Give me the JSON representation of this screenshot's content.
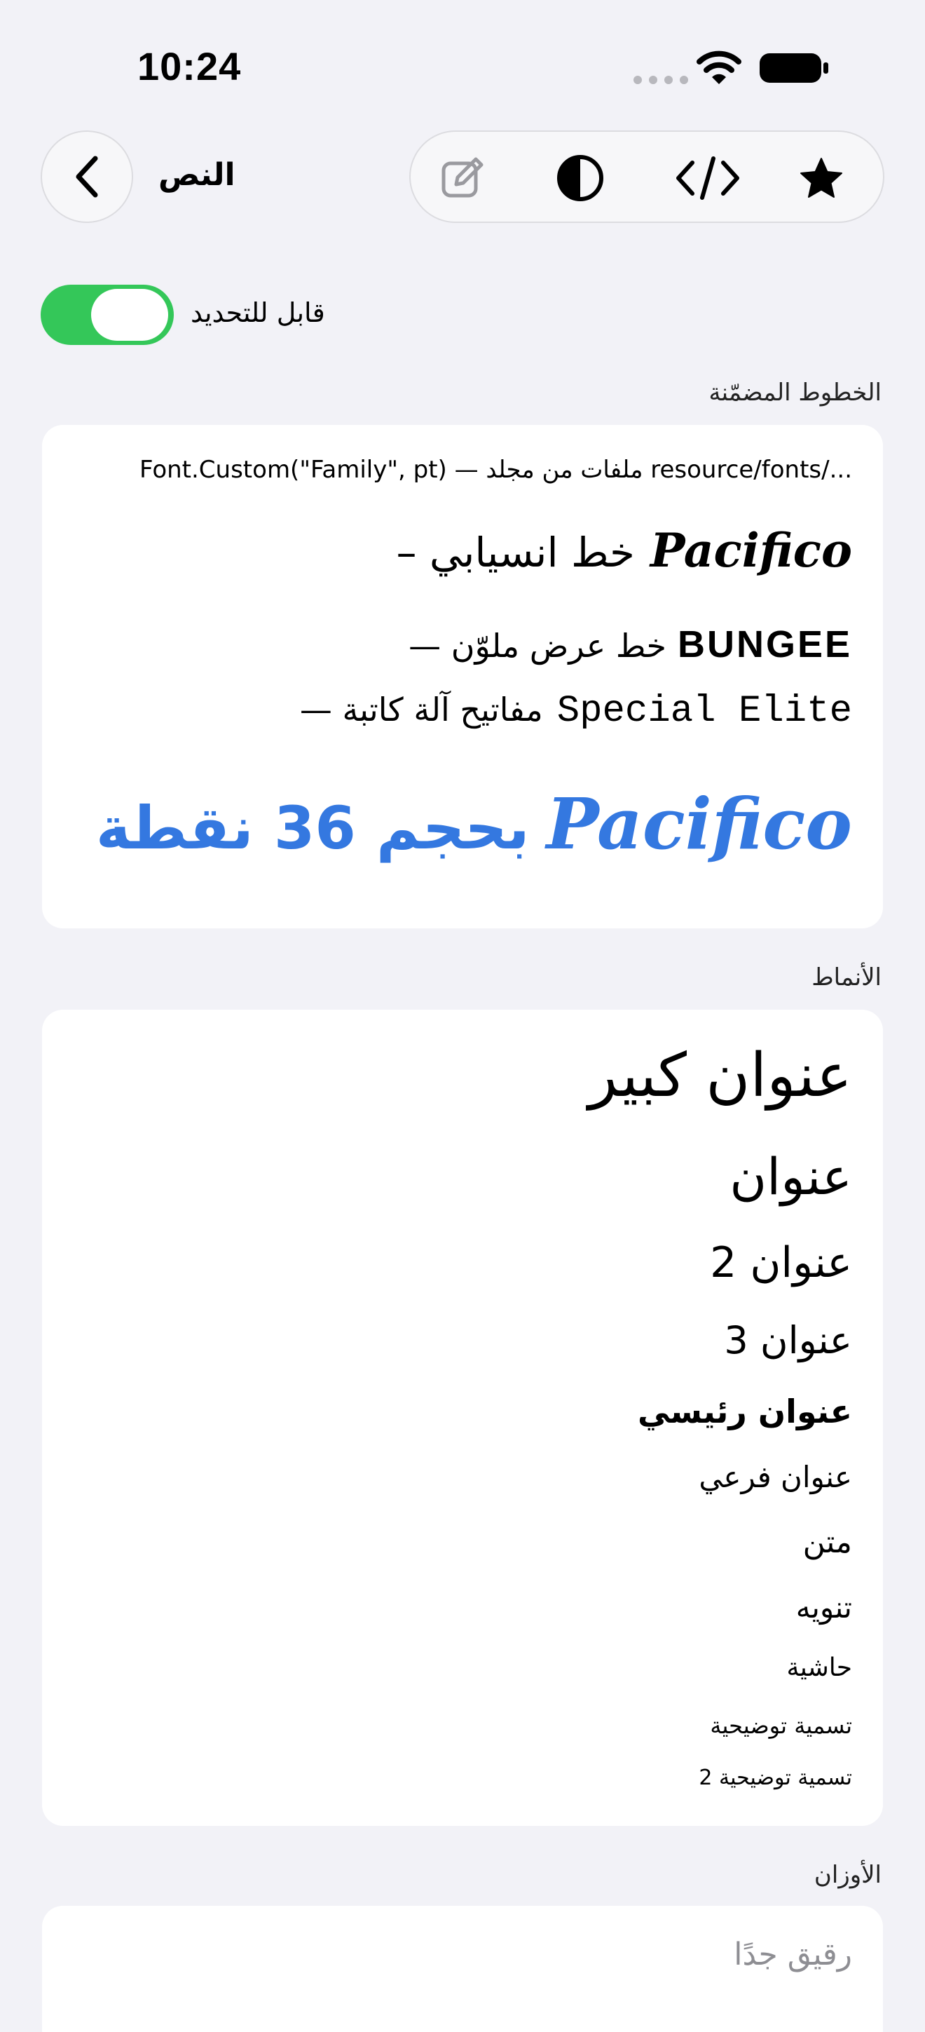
{
  "status_bar": {
    "time": "10:24"
  },
  "nav": {
    "title": "النص",
    "back_icon": "chevron-left-icon",
    "toolbar_icons": [
      "compose-icon",
      "contrast-icon",
      "code-icon",
      "star-icon"
    ]
  },
  "toggle": {
    "label": "قابل للتحديد",
    "on": true
  },
  "embedded_fonts": {
    "header": "الخطوط المضمّنة",
    "note": "Font.Custom(\"Family\", pt) — ملفات من مجلد resource/fonts/...",
    "script_arabic": "خط انسيابي –",
    "script_latin": "Pacifico",
    "display_arabic": "خط عرض ملوّن —",
    "display_latin": "BUNGEE",
    "typewriter_arabic": "مفاتيح آلة كاتبة —",
    "typewriter_latin": "Special Elite",
    "big_arabic": "بحجم 36 نقطة",
    "big_latin": "Pacifico",
    "accent_color": "#3478e0"
  },
  "styles": {
    "header": "الأنماط",
    "items": [
      "عنوان كبير",
      "عنوان",
      "عنوان 2",
      "عنوان 3",
      "عنوان رئيسي",
      "عنوان فرعي",
      "متن",
      "تنويه",
      "حاشية",
      "تسمية توضيحية",
      "تسمية توضيحية 2"
    ]
  },
  "weights": {
    "header": "الأوزان",
    "items": [
      "رقيق جدًا"
    ]
  }
}
